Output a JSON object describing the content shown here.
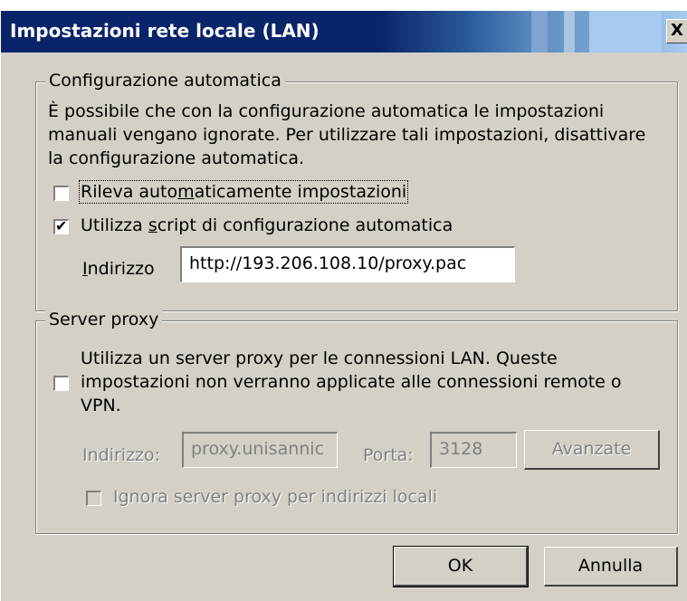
{
  "dialog": {
    "title": "Impostazioni rete locale (LAN)",
    "close_glyph": "X"
  },
  "auto_config": {
    "legend": "Configurazione automatica",
    "description": [
      "È possibile che con la configurazione automatica le impostazioni",
      "manuali vengano ignorate. Per utilizzare tali impostazioni, disattivare",
      "la configurazione automatica."
    ],
    "detect_checkbox": {
      "label_pre": "Rileva auto",
      "label_ul": "m",
      "label_post": "aticamente impostazioni",
      "checked": false
    },
    "script_checkbox": {
      "label_pre": "Utilizza ",
      "label_ul": "s",
      "label_post": "cript di configurazione automatica",
      "checked": true
    },
    "address": {
      "label_ul": "I",
      "label_post": "ndirizzo",
      "value": "http://193.206.108.10/proxy.pac"
    }
  },
  "proxy": {
    "legend": "Server proxy",
    "checkbox": {
      "lines": [
        "Utilizza un server proxy per le connessioni LAN. Queste",
        "impostazioni non verranno applicate alle connessioni remote o",
        "VPN."
      ],
      "checked": false
    },
    "address_label": "Indirizzo:",
    "address_value": "proxy.unisannic",
    "port_label": "Porta:",
    "port_value": "3128",
    "advanced_button": "Avanzate",
    "bypass_checkbox": {
      "label": "Ignora server proxy per indirizzi locali",
      "checked": false
    }
  },
  "buttons": {
    "ok": "OK",
    "cancel": "Annulla"
  },
  "colors": {
    "dialog_bg": "#d4d0c8",
    "title_bg": "#0a246a",
    "disabled_text": "#808080"
  }
}
